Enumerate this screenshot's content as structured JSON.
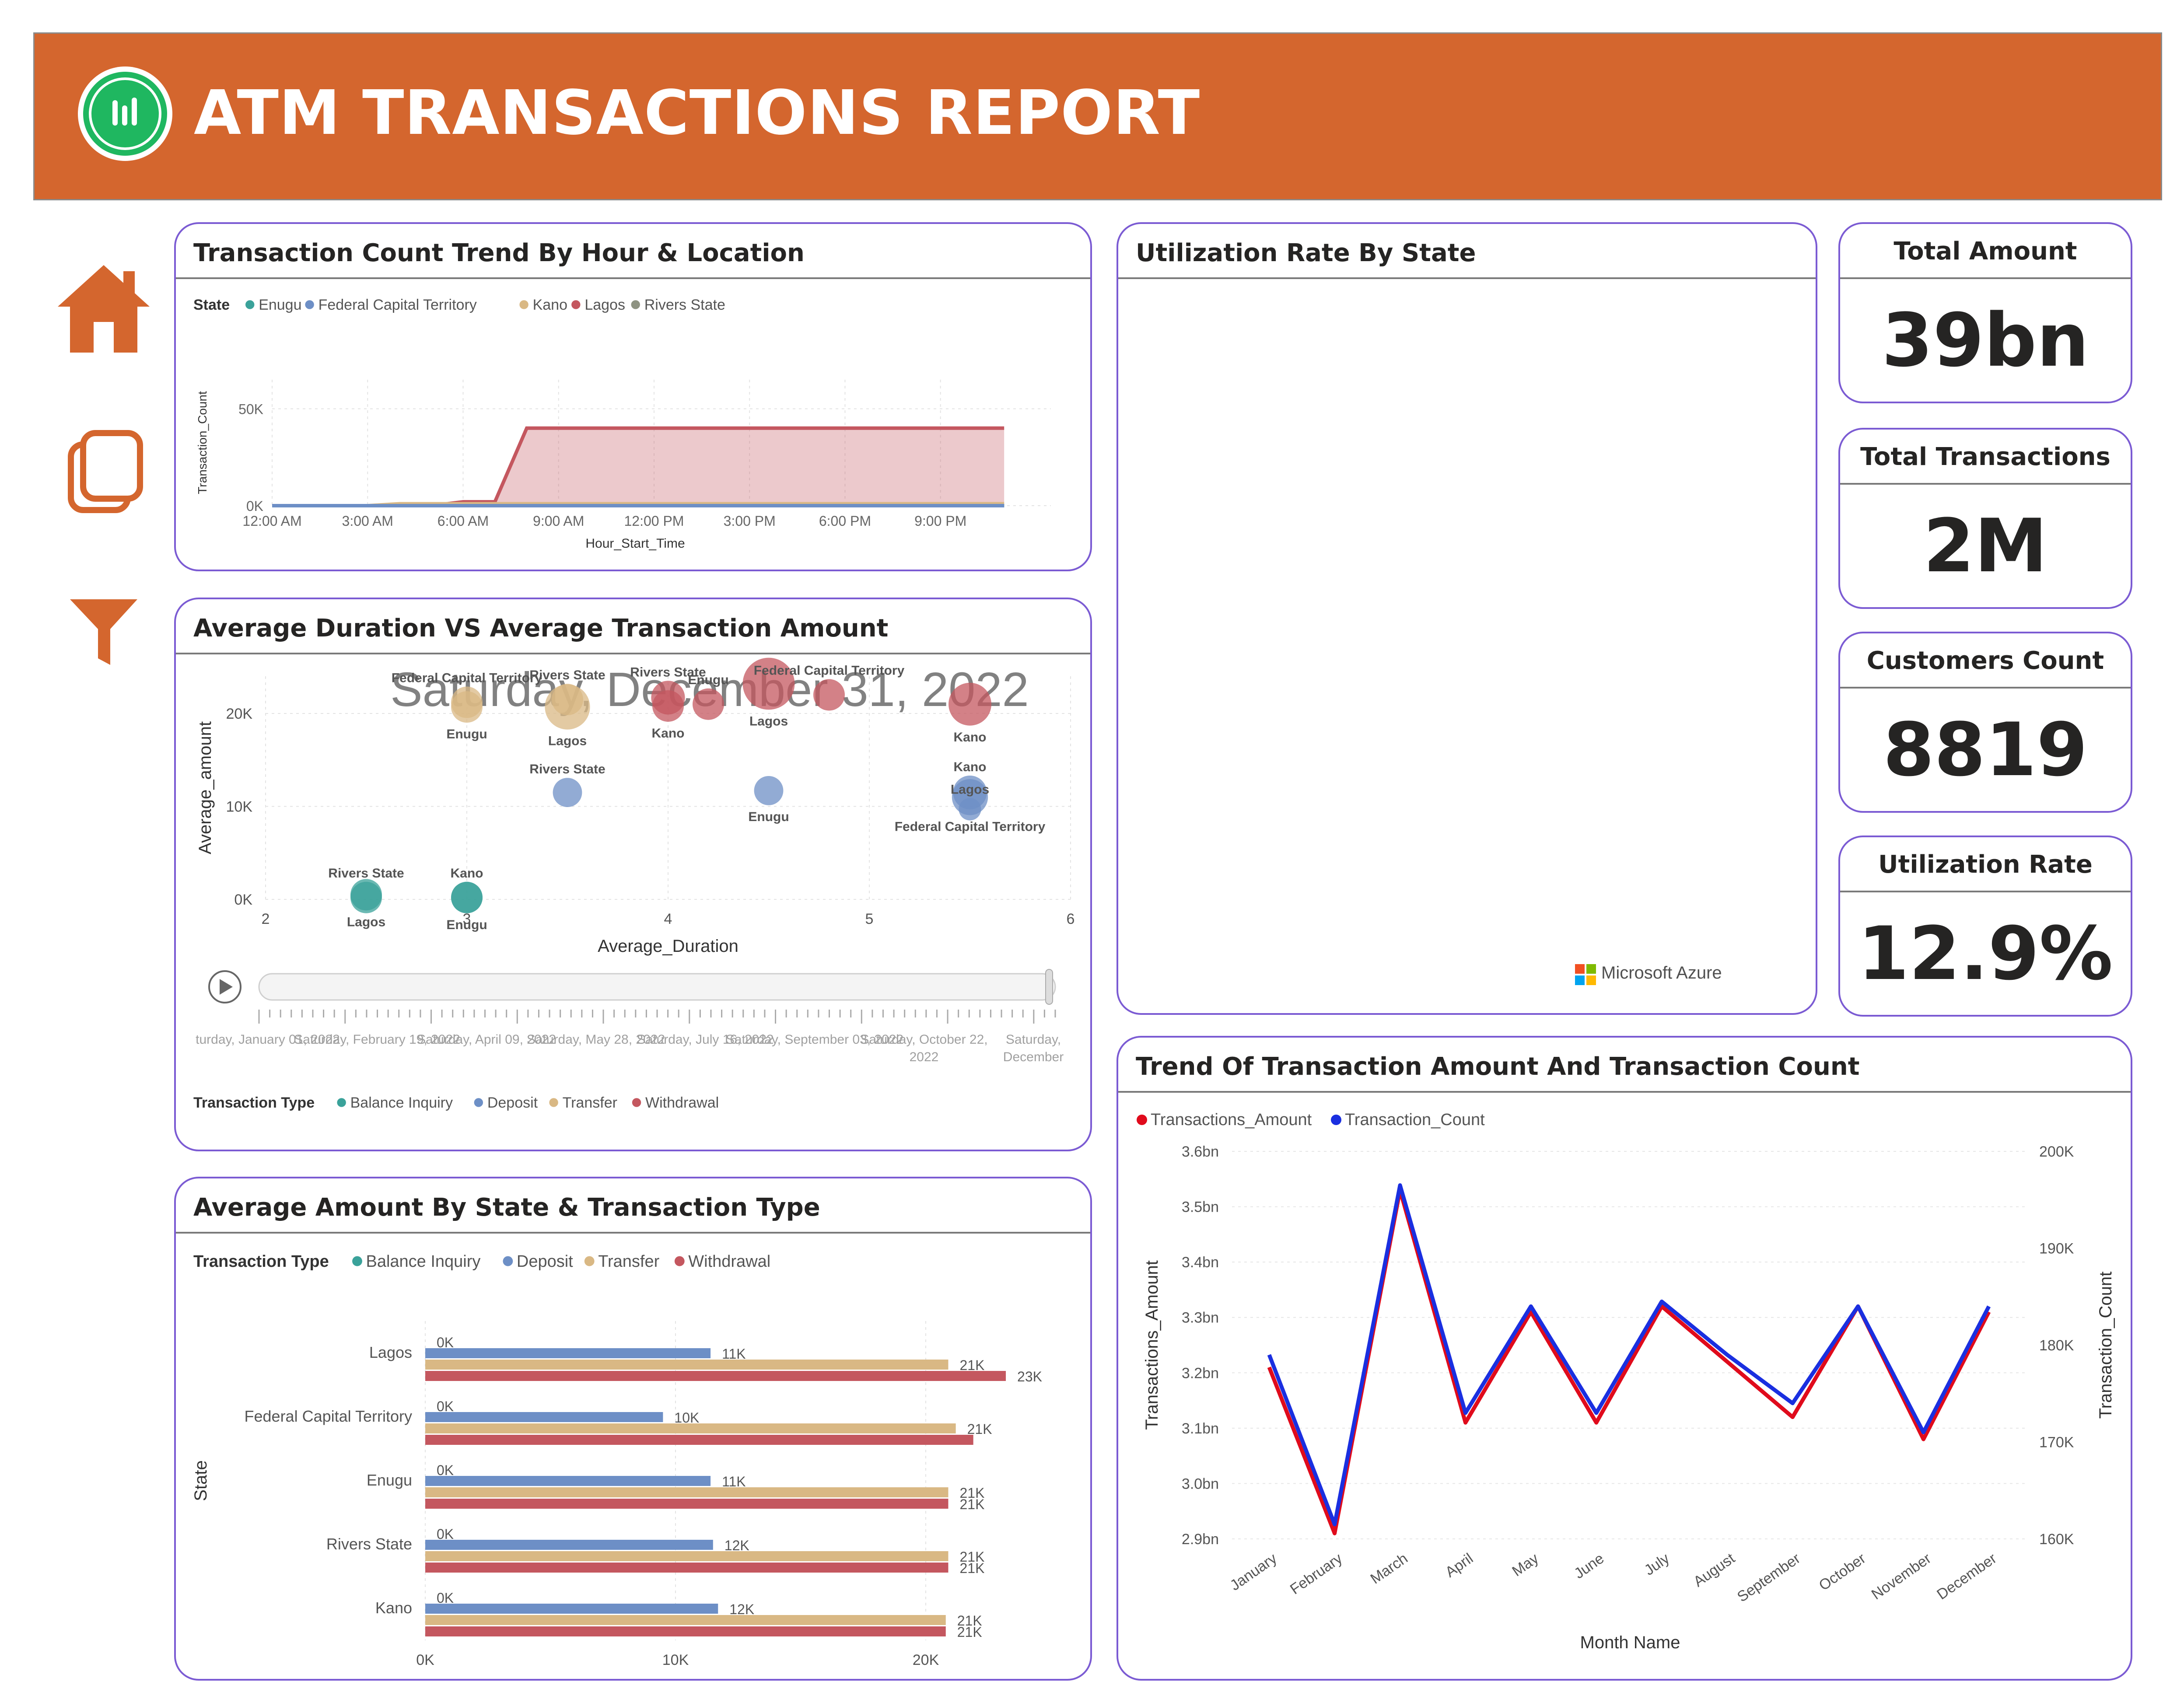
{
  "header": {
    "title": "ATM TRANSACTIONS REPORT"
  },
  "nav": {
    "items": [
      "home-icon",
      "pages-icon",
      "filter-icon"
    ]
  },
  "colors": {
    "header": "#d4662e",
    "card_border": "#7b5bd3",
    "enugu": "#3aa29a",
    "fct": "#6d8fc6",
    "kano": "#d9b884",
    "lagos": "#c4575f",
    "rivers": "#8e9382",
    "balance_inquiry": "#3aa29a",
    "deposit": "#6d8fc6",
    "transfer": "#d9b884",
    "withdrawal": "#c4575f",
    "amount_line": "#e00b1c",
    "count_line": "#1a2fe0"
  },
  "trend_hour": {
    "title": "Transaction Count Trend By Hour & Location",
    "legend_title": "State",
    "legend": [
      "Enugu",
      "Federal Capital Territory",
      "Kano",
      "Lagos",
      "Rivers State"
    ]
  },
  "scatter": {
    "title": "Average Duration VS Average Transaction Amount",
    "date_overlay": "Saturday, December 31, 2022",
    "legend_title": "Transaction Type",
    "legend": [
      "Balance Inquiry",
      "Deposit",
      "Transfer",
      "Withdrawal"
    ],
    "play_axis_labels": [
      {
        "lines": [
          "turday, January 01, 2022"
        ]
      },
      {
        "lines": [
          "Saturday, February 19, 2022"
        ]
      },
      {
        "lines": [
          "Saturday, April 09, 2022"
        ]
      },
      {
        "lines": [
          "Saturday, May 28, 2022"
        ]
      },
      {
        "lines": [
          "Saturday, July 16, 2022"
        ]
      },
      {
        "lines": [
          "Saturday, September 03, 2022"
        ]
      },
      {
        "lines": [
          "Saturday, October 22,",
          "2022"
        ]
      },
      {
        "lines": [
          "Saturday,",
          "December"
        ]
      }
    ]
  },
  "bars": {
    "title": "Average Amount By State & Transaction Type",
    "legend_title": "Transaction Type",
    "legend": [
      "Balance Inquiry",
      "Deposit",
      "Transfer",
      "Withdrawal"
    ]
  },
  "utilization_map": {
    "title": "Utilization Rate By State",
    "attribution": "Microsoft Azure"
  },
  "kpis": [
    {
      "label": "Total Amount",
      "value": "39bn"
    },
    {
      "label": "Total Transactions",
      "value": "2M"
    },
    {
      "label": "Customers Count",
      "value": "8819"
    },
    {
      "label": "Utilization Rate",
      "value": "12.9%"
    }
  ],
  "trend_month": {
    "title": "Trend Of Transaction Amount And Transaction Count",
    "legend": [
      "Transactions_Amount",
      "Transaction_Count"
    ]
  },
  "chart_data": [
    {
      "type": "area",
      "title": "Transaction Count Trend By Hour & Location",
      "xlabel": "Hour_Start_Time",
      "ylabel": "Transaction_Count",
      "x_ticks": [
        "12:00 AM",
        "3:00 AM",
        "6:00 AM",
        "9:00 AM",
        "12:00 PM",
        "3:00 PM",
        "6:00 PM",
        "9:00 PM"
      ],
      "y_ticks": [
        "0K",
        "50K"
      ],
      "ylim": [
        0,
        65000
      ],
      "x": [
        0,
        1,
        2,
        3,
        4,
        5,
        6,
        7,
        8,
        9,
        10,
        11,
        12,
        13,
        14,
        15,
        16,
        17,
        18,
        19,
        20,
        21,
        22,
        23
      ],
      "series": [
        {
          "name": "Lagos",
          "values": [
            0,
            0,
            0,
            0,
            0,
            0,
            2000,
            2000,
            40000,
            40000,
            40000,
            40000,
            40000,
            40000,
            40000,
            40000,
            40000,
            40000,
            40000,
            40000,
            40000,
            40000,
            40000,
            40000
          ]
        },
        {
          "name": "Kano",
          "values": [
            0,
            0,
            0,
            0,
            1000,
            1000,
            1000,
            1000,
            1000,
            1000,
            1000,
            1000,
            1000,
            1000,
            1000,
            1000,
            1000,
            1000,
            1000,
            1000,
            1000,
            1000,
            1000,
            1000
          ]
        },
        {
          "name": "Enugu",
          "values": [
            0,
            0,
            0,
            0,
            0,
            0,
            0,
            0,
            0,
            0,
            0,
            0,
            0,
            0,
            0,
            0,
            0,
            0,
            0,
            0,
            0,
            0,
            0,
            0
          ]
        },
        {
          "name": "Federal Capital Territory",
          "values": [
            0,
            0,
            0,
            0,
            0,
            0,
            0,
            0,
            0,
            0,
            0,
            0,
            0,
            0,
            0,
            0,
            0,
            0,
            0,
            0,
            0,
            0,
            0,
            0
          ]
        },
        {
          "name": "Rivers State",
          "values": [
            0,
            0,
            0,
            0,
            0,
            0,
            0,
            0,
            0,
            0,
            0,
            0,
            0,
            0,
            0,
            0,
            0,
            0,
            0,
            0,
            0,
            0,
            0,
            0
          ]
        }
      ]
    },
    {
      "type": "scatter",
      "title": "Average Duration VS Average Transaction Amount",
      "xlabel": "Average_Duration",
      "ylabel": "Average_amount",
      "x_ticks": [
        2,
        3,
        4,
        5,
        6
      ],
      "y_ticks": [
        "0K",
        "10K",
        "20K"
      ],
      "xlim": [
        2,
        6
      ],
      "ylim": [
        0,
        24000
      ],
      "points": [
        {
          "label": "Federal Capital Territory",
          "type": "Transfer",
          "x": 3.0,
          "y": 21200,
          "size": 1.0
        },
        {
          "label": "Enugu",
          "type": "Transfer",
          "x": 3.0,
          "y": 20700,
          "size": 1.0
        },
        {
          "label": "Rivers State",
          "type": "Transfer",
          "x": 3.5,
          "y": 21500,
          "size": 1.0
        },
        {
          "label": "Lagos",
          "type": "Transfer",
          "x": 3.5,
          "y": 20700,
          "size": 1.6
        },
        {
          "label": "Rivers State",
          "type": "Withdrawal",
          "x": 4.0,
          "y": 21700,
          "size": 1.1
        },
        {
          "label": "Kano",
          "type": "Withdrawal",
          "x": 4.0,
          "y": 20800,
          "size": 1.0
        },
        {
          "label": "Enugu",
          "type": "Withdrawal",
          "x": 4.2,
          "y": 21000,
          "size": 1.0
        },
        {
          "label": "Lagos",
          "type": "Withdrawal",
          "x": 4.5,
          "y": 23200,
          "size": 1.9
        },
        {
          "label": "Federal Capital Territory",
          "type": "Withdrawal",
          "x": 4.8,
          "y": 22000,
          "size": 1.0
        },
        {
          "label": "Kano",
          "type": "Withdrawal",
          "x": 5.5,
          "y": 21000,
          "size": 1.5
        },
        {
          "label": "Rivers State",
          "type": "Deposit",
          "x": 3.5,
          "y": 11500,
          "size": 0.9
        },
        {
          "label": "Enugu",
          "type": "Deposit",
          "x": 4.5,
          "y": 11700,
          "size": 0.9
        },
        {
          "label": "Kano",
          "type": "Deposit",
          "x": 5.5,
          "y": 11500,
          "size": 1.1
        },
        {
          "label": "Federal Capital Territory",
          "type": "Deposit",
          "x": 5.5,
          "y": 11000,
          "size": 1.2
        },
        {
          "label": "Lagos",
          "type": "Deposit",
          "x": 5.5,
          "y": 9700,
          "size": 0.6
        },
        {
          "label": "Lagos",
          "type": "Balance Inquiry",
          "x": 2.5,
          "y": 500,
          "size": 1.0
        },
        {
          "label": "Rivers State",
          "type": "Balance Inquiry",
          "x": 2.5,
          "y": 200,
          "size": 1.0
        },
        {
          "label": "Enugu",
          "type": "Balance Inquiry",
          "x": 3.0,
          "y": 200,
          "size": 1.0
        },
        {
          "label": "Kano",
          "type": "Balance Inquiry",
          "x": 3.0,
          "y": 200,
          "size": 1.0
        }
      ]
    },
    {
      "type": "bar",
      "orientation": "horizontal",
      "title": "Average Amount By State & Transaction Type",
      "xlabel": "Average_amount",
      "ylabel": "State",
      "x_ticks": [
        "0K",
        "10K",
        "20K"
      ],
      "xlim": [
        0,
        25000
      ],
      "categories": [
        "Lagos",
        "Federal Capital Territory",
        "Enugu",
        "Rivers State",
        "Kano"
      ],
      "series": [
        {
          "name": "Balance Inquiry",
          "values": [
            0,
            0,
            0,
            0,
            0
          ],
          "labels": [
            "0K",
            "0K",
            "0K",
            "0K",
            "0K"
          ]
        },
        {
          "name": "Deposit",
          "values": [
            11400,
            9500,
            11400,
            11500,
            11700
          ],
          "labels": [
            "11K",
            "10K",
            "11K",
            "12K",
            "12K"
          ]
        },
        {
          "name": "Transfer",
          "values": [
            20900,
            21200,
            20900,
            20900,
            20800
          ],
          "labels": [
            "21K",
            "21K",
            "21K",
            "21K",
            "21K"
          ]
        },
        {
          "name": "Withdrawal",
          "values": [
            23200,
            21900,
            20900,
            20900,
            20800
          ],
          "labels": [
            "23K",
            "",
            "21K",
            "21K",
            "21K"
          ]
        }
      ]
    },
    {
      "type": "line",
      "title": "Trend Of Transaction Amount And Transaction Count",
      "xlabel": "Month Name",
      "ylabel": "Transactions_Amount",
      "ylabel2": "Transaction_Count",
      "categories": [
        "January",
        "February",
        "March",
        "April",
        "May",
        "June",
        "July",
        "August",
        "September",
        "October",
        "November",
        "December"
      ],
      "y_ticks": [
        "2.9bn",
        "3.0bn",
        "3.1bn",
        "3.2bn",
        "3.3bn",
        "3.4bn",
        "3.5bn",
        "3.6bn"
      ],
      "y2_ticks": [
        "160K",
        "170K",
        "180K",
        "190K",
        "200K"
      ],
      "ylim": [
        2.9,
        3.6
      ],
      "y2lim": [
        160000,
        200000
      ],
      "series": [
        {
          "name": "Transactions_Amount",
          "axis": "left",
          "values": [
            3.21,
            2.91,
            3.53,
            3.11,
            3.31,
            3.11,
            3.32,
            3.22,
            3.12,
            3.32,
            3.08,
            3.31
          ]
        },
        {
          "name": "Transaction_Count",
          "axis": "right",
          "values": [
            179000,
            161500,
            196500,
            173000,
            184000,
            173000,
            184500,
            179000,
            174000,
            184000,
            171000,
            184000
          ]
        }
      ]
    }
  ]
}
